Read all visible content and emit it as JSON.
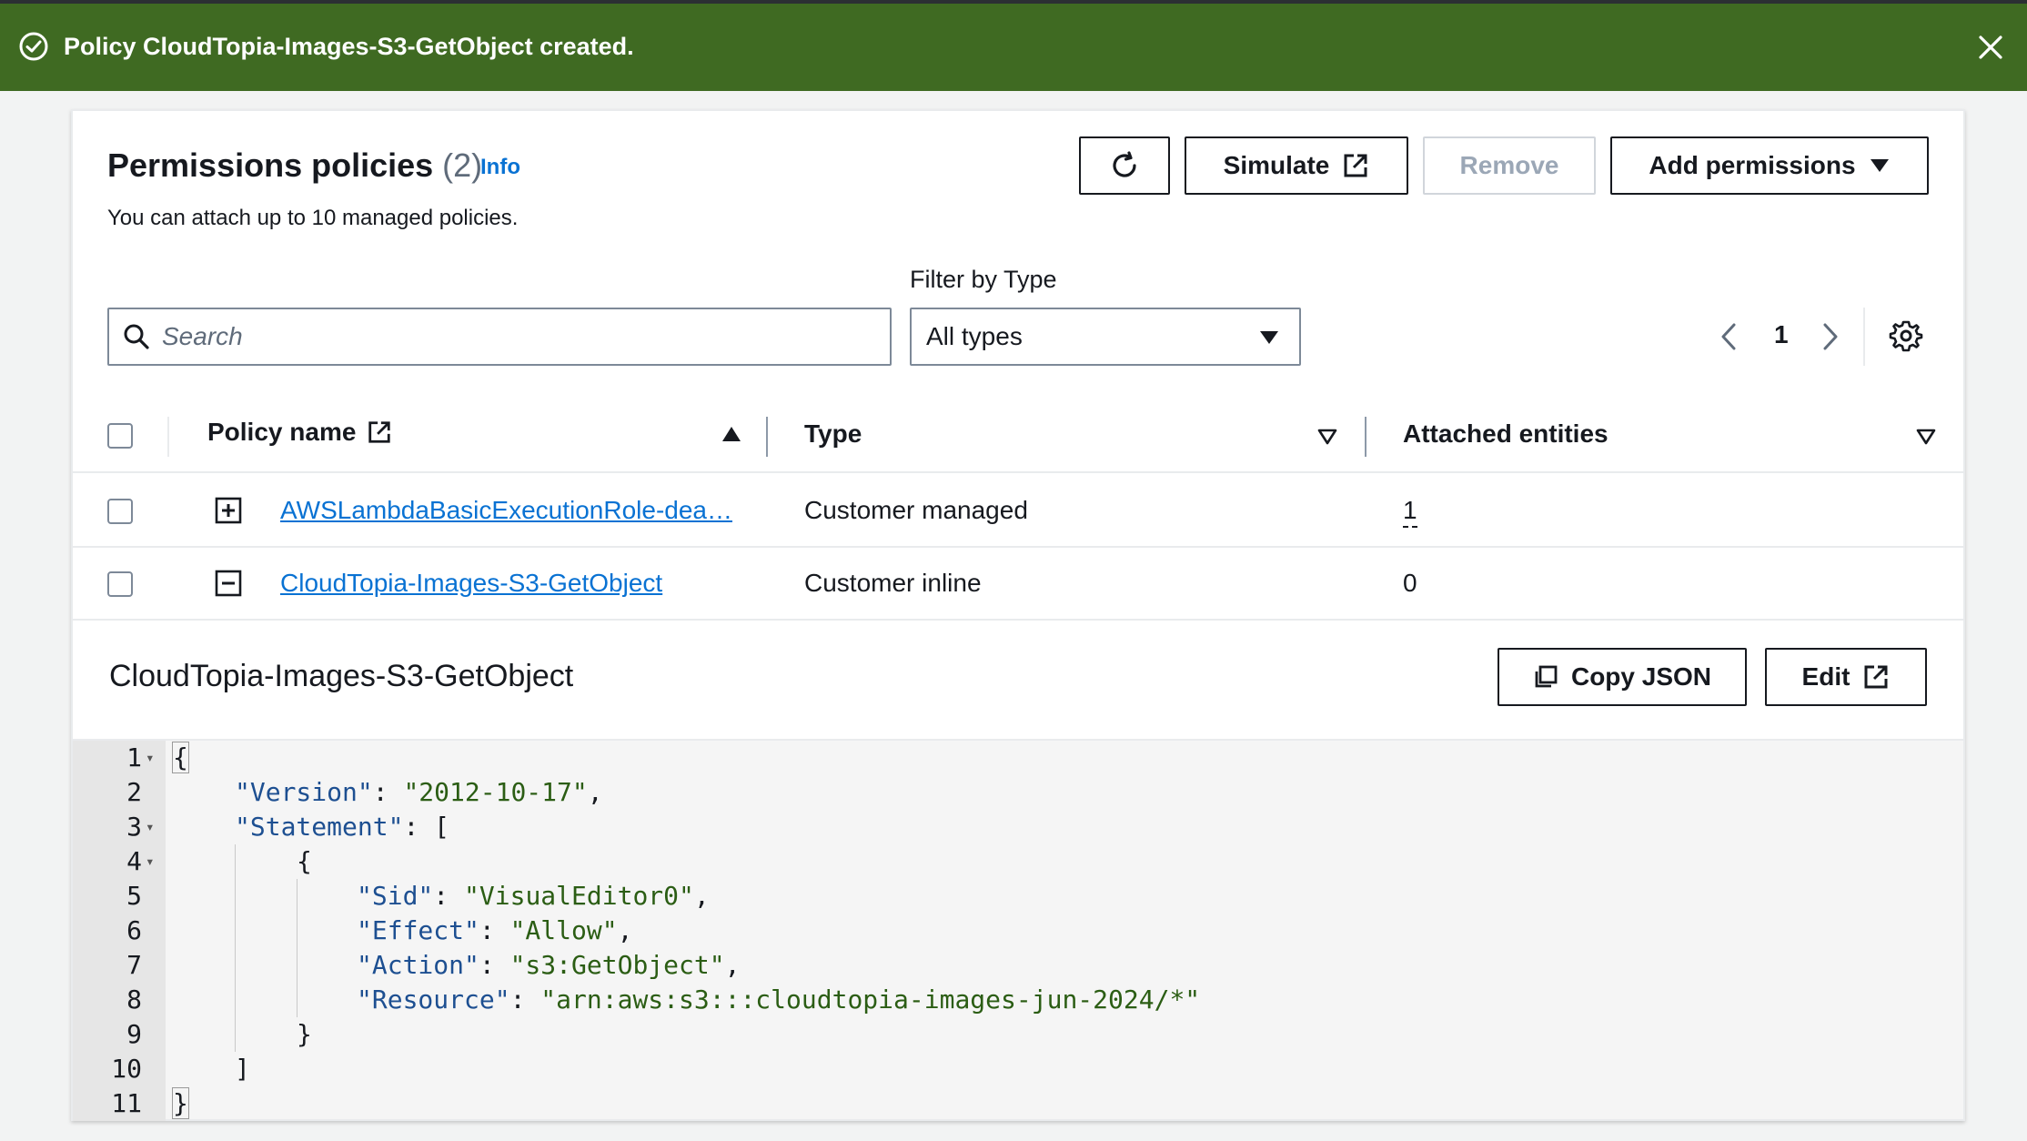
{
  "flash": {
    "message": "Policy CloudTopia-Images-S3-GetObject created."
  },
  "header": {
    "title": "Permissions policies",
    "count": "(2)",
    "info": "Info",
    "description": "You can attach up to 10 managed policies."
  },
  "actions": {
    "simulate": "Simulate",
    "remove": "Remove",
    "add_permissions": "Add permissions"
  },
  "filters": {
    "search_placeholder": "Search",
    "type_label": "Filter by Type",
    "type_value": "All types"
  },
  "pagination": {
    "current_page": "1"
  },
  "table": {
    "columns": {
      "policy_name": "Policy name",
      "type": "Type",
      "attached_entities": "Attached entities"
    },
    "rows": [
      {
        "name": "AWSLambdaBasicExecutionRole-dea…",
        "type": "Customer managed",
        "attached": "1"
      },
      {
        "name": "CloudTopia-Images-S3-GetObject",
        "type": "Customer inline",
        "attached": "0"
      }
    ]
  },
  "detail": {
    "title": "CloudTopia-Images-S3-GetObject",
    "copy_json": "Copy JSON",
    "edit": "Edit",
    "code": {
      "line_numbers": [
        "1",
        "2",
        "3",
        "4",
        "5",
        "6",
        "7",
        "8",
        "9",
        "10",
        "11"
      ],
      "open_brace": "{",
      "version_key": "\"Version\"",
      "version_value": "\"2012-10-17\"",
      "statement_key": "\"Statement\"",
      "statement_open": "[",
      "object_open": "{",
      "sid_key": "\"Sid\"",
      "sid_value": "\"VisualEditor0\"",
      "effect_key": "\"Effect\"",
      "effect_value": "\"Allow\"",
      "action_key": "\"Action\"",
      "action_value": "\"s3:GetObject\"",
      "resource_key": "\"Resource\"",
      "resource_value": "\"arn:aws:s3:::cloudtopia-images-jun-2024/*\"",
      "object_close": "}",
      "statement_close": "]",
      "close_brace": "}"
    }
  }
}
